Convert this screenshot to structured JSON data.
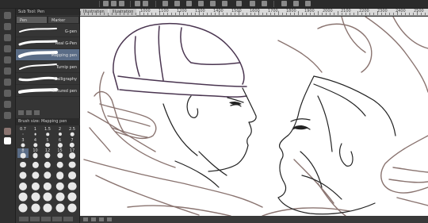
{
  "toolbar": {
    "icons": [
      "menu-icon",
      "grid-icon",
      "pen-icon",
      "undo-icon",
      "redo-icon",
      "flip-icon",
      "rotate-icon",
      "snap-icon",
      "ruler-icon",
      "square-icon",
      "dropper-icon",
      "hand-icon",
      "zoom-icon",
      "fill-icon",
      "layer-icon",
      "file-icon",
      "save-icon"
    ]
  },
  "canvas_tabs": [
    "Illustration",
    "Illustration"
  ],
  "ruler_numbers": [
    "1000",
    "1100",
    "1200",
    "1300",
    "1400",
    "1500",
    "1600",
    "1700",
    "1800",
    "1900",
    "2000",
    "2100",
    "2200",
    "2300",
    "2400",
    "2500"
  ],
  "tool_panel": {
    "header": "Sub Tool: Pen",
    "tabs": [
      "Pen",
      "Marker"
    ],
    "brushes": [
      {
        "name": "G-pen",
        "selected": false
      },
      {
        "name": "Real G-Pen",
        "selected": false
      },
      {
        "name": "Mapping pen",
        "selected": true
      },
      {
        "name": "Turnip pen",
        "selected": false
      },
      {
        "name": "Calligraphy",
        "selected": false
      },
      {
        "name": "Textured pen",
        "selected": false
      }
    ]
  },
  "brush_size": {
    "header": "Brush size: Mapping pen",
    "values": [
      "0.7",
      "1",
      "1.5",
      "2",
      "2.5",
      "3",
      "4",
      "5",
      "6",
      "7",
      "8",
      "10",
      "12",
      "15",
      "17",
      "20",
      "25",
      "30",
      "40",
      "50",
      "60",
      "70",
      "80",
      "100",
      "120",
      "150",
      "170",
      "200",
      "250",
      "300",
      "400",
      "500",
      "600",
      "700",
      "800",
      "1000",
      "1200",
      "1500",
      "1700",
      "2000"
    ],
    "selected_index": 10,
    "footer": [
      "",
      "",
      "",
      "",
      ""
    ]
  },
  "colors": {
    "line": "#8a7470",
    "ink": "#222222",
    "helmet": "#4a3550",
    "selection": "#5a6c86"
  }
}
